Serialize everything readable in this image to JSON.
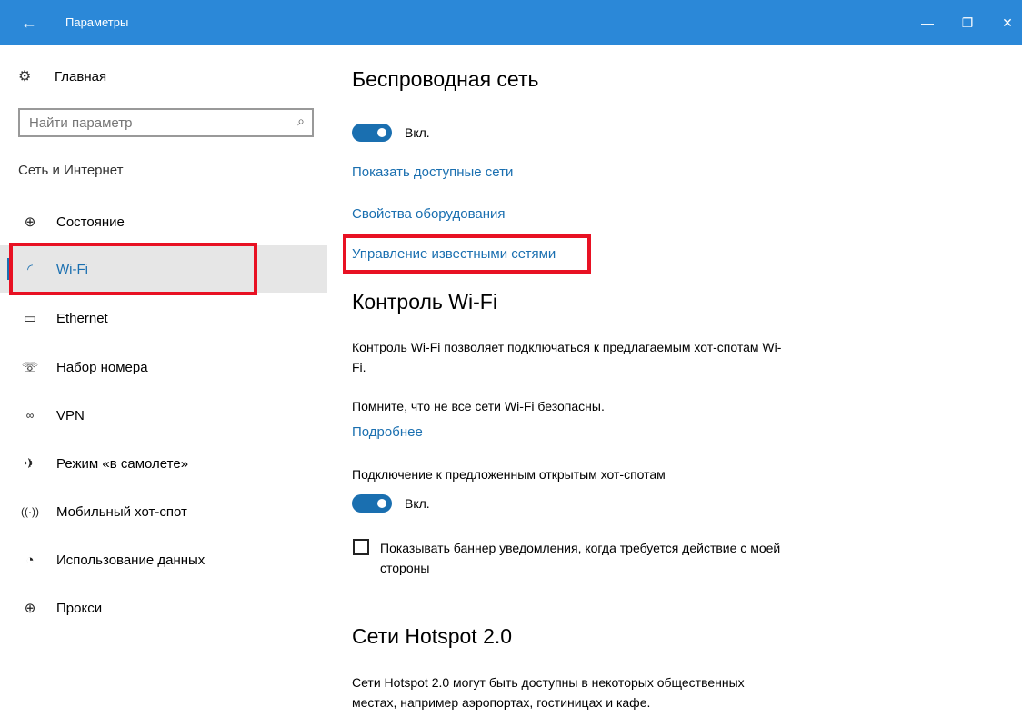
{
  "window": {
    "title": "Параметры",
    "back_icon": "←",
    "minimize_icon": "—",
    "maximize_icon": "❐",
    "close_icon": "✕"
  },
  "sidebar": {
    "home": {
      "label": "Главная",
      "icon": "gear-icon"
    },
    "search": {
      "placeholder": "Найти параметр",
      "value": ""
    },
    "section_title": "Сеть и Интернет",
    "items": [
      {
        "label": "Состояние",
        "icon": "globe-icon"
      },
      {
        "label": "Wi-Fi",
        "icon": "wifi-icon",
        "selected": true
      },
      {
        "label": "Ethernet",
        "icon": "ethernet-icon"
      },
      {
        "label": "Набор номера",
        "icon": "dialup-icon"
      },
      {
        "label": "VPN",
        "icon": "vpn-icon"
      },
      {
        "label": "Режим «в самолете»",
        "icon": "airplane-icon"
      },
      {
        "label": "Мобильный хот-спот",
        "icon": "hotspot-icon"
      },
      {
        "label": "Использование данных",
        "icon": "data-usage-icon"
      },
      {
        "label": "Прокси",
        "icon": "globe-icon"
      }
    ]
  },
  "content": {
    "wireless": {
      "heading": "Беспроводная сеть",
      "toggle_label": "Вкл.",
      "toggle_on": true,
      "links": [
        "Показать доступные сети",
        "Свойства оборудования",
        "Управление известными сетями"
      ]
    },
    "wifi_sense": {
      "heading": "Контроль Wi-Fi",
      "desc": "Контроль Wi-Fi позволяет подключаться к предлагаемым хот-спотам Wi-Fi.",
      "warning": "Помните, что не все сети Wi-Fi безопасны.",
      "more_link": "Подробнее",
      "open_hotspots_label": "Подключение к предложенным открытым хот-спотам",
      "toggle_label": "Вкл.",
      "toggle_on": true,
      "checkbox_label": "Показывать баннер уведомления, когда требуется действие с моей стороны",
      "checkbox_checked": false
    },
    "hotspot2": {
      "heading": "Сети Hotspot 2.0",
      "desc": "Сети Hotspot 2.0 могут быть доступны в некоторых общественных местах, например аэропортах, гостиницах и кафе."
    }
  },
  "colors": {
    "titlebar": "#2b88d8",
    "accent": "#1a6fb0",
    "highlight_box": "#e81123",
    "selected_bg": "#e6e6e6"
  }
}
